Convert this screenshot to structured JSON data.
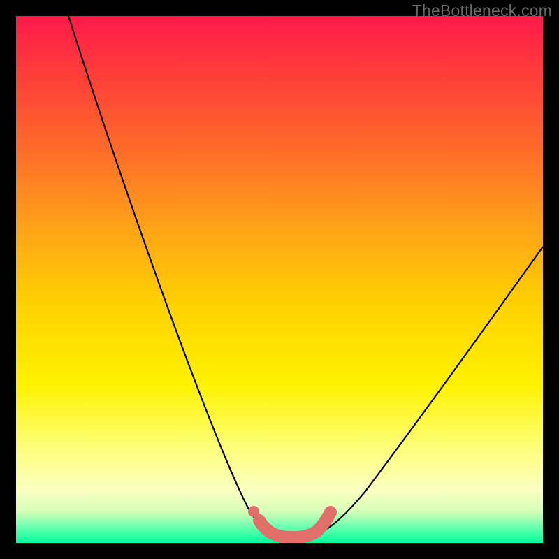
{
  "watermark": "TheBottleneck.com",
  "chart_data": {
    "type": "line",
    "title": "",
    "xlabel": "",
    "ylabel": "",
    "xlim": [
      0,
      100
    ],
    "ylim": [
      0,
      100
    ],
    "series": [
      {
        "name": "bottleneck-curve",
        "x": [
          10,
          15,
          20,
          25,
          30,
          35,
          40,
          43,
          46,
          48,
          50,
          52,
          54,
          56,
          58,
          62,
          68,
          74,
          80,
          86,
          92,
          98
        ],
        "y": [
          100,
          86,
          72,
          59,
          46,
          33,
          20,
          12,
          5,
          2,
          1,
          1,
          1,
          2,
          3,
          8,
          15,
          23,
          31,
          40,
          49,
          58
        ]
      },
      {
        "name": "highlight-band",
        "x": [
          46,
          48,
          50,
          52,
          54,
          56
        ],
        "y": [
          4,
          2,
          1,
          1,
          2,
          3
        ]
      }
    ],
    "annotations": [
      {
        "name": "highlight-dot",
        "x": 46,
        "y": 5
      }
    ]
  }
}
